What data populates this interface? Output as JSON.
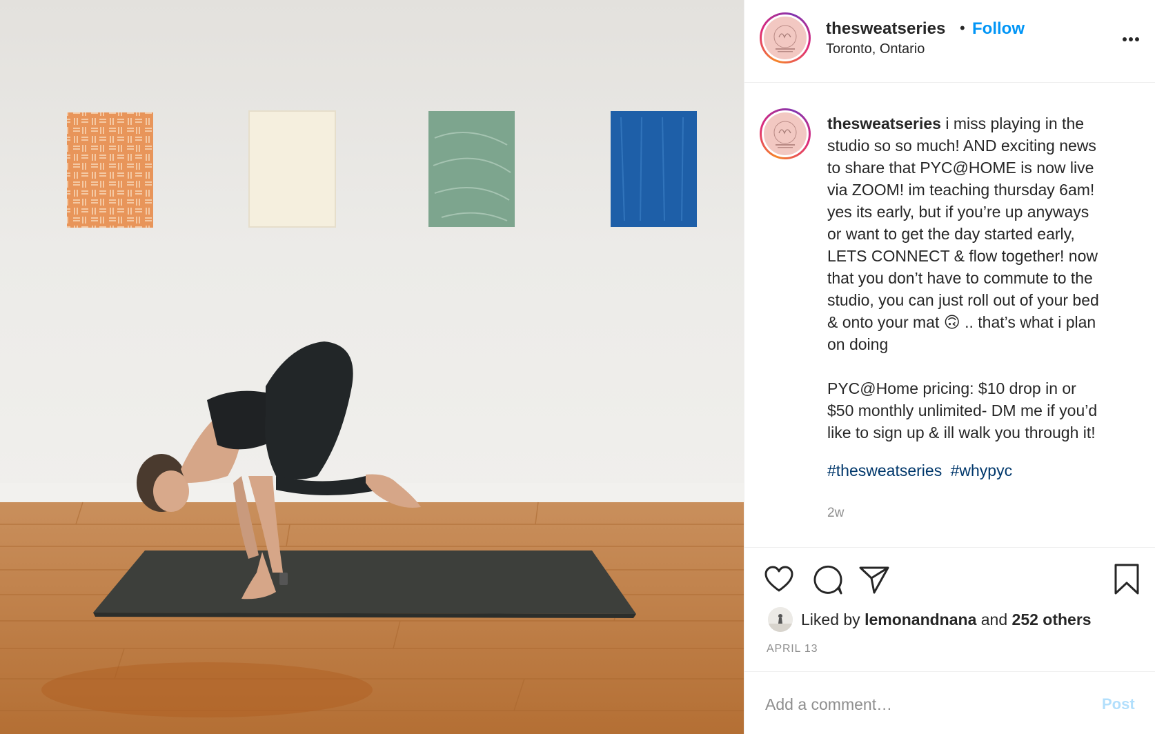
{
  "post": {
    "username": "thesweatseries",
    "separator": "•",
    "follow_label": "Follow",
    "location": "Toronto, Ontario",
    "more_icon": "more-horizontal-icon",
    "caption_lines_1": [
      "i miss playing in the",
      "studio so so much! AND exciting news",
      "to share that PYC@HOME is now live",
      "via ZOOM! im teaching thursday 6am!",
      "yes its early, but if you’re up anyways",
      "or want to get the day started early,",
      "LETS CONNECT & flow together! now",
      "that you don’t have to commute to the",
      "studio, you can just roll out of your bed",
      "& onto your mat",
      ".. that’s what i plan",
      "on doing"
    ],
    "emoji": "🙃",
    "caption_lines_2": [
      "PYC@Home pricing: $10 drop in or",
      "$50 monthly unlimited- DM me if you’d",
      "like to sign up & ill walk you through it!"
    ],
    "hashtags": [
      "#thesweatseries",
      "#whypyc"
    ],
    "time_ago": "2w",
    "likes": {
      "prefix": "Liked by",
      "user": "lemonandnana",
      "middle": "and",
      "others": "252 others"
    },
    "date": "APRIL 13",
    "comment": {
      "placeholder": "Add a comment…",
      "post_label": "Post"
    }
  },
  "colors": {
    "link_blue": "#0095f6",
    "hashtag_blue": "#00376b",
    "muted": "#8e8e8e",
    "post_disabled": "#b2dffc",
    "avatar_bg": "#f2c8c2"
  },
  "icons": [
    "heart-icon",
    "comment-icon",
    "share-icon",
    "bookmark-icon"
  ]
}
